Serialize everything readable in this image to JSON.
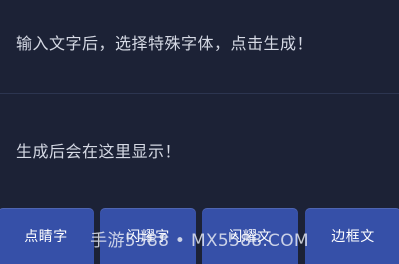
{
  "input": {
    "placeholder": "输入文字后，选择特殊字体，点击生成！"
  },
  "output": {
    "placeholder": "生成后会在这里显示！"
  },
  "buttons": [
    {
      "label": "点睛字"
    },
    {
      "label": "闪耀字"
    },
    {
      "label": "闪耀文"
    },
    {
      "label": "边框文"
    }
  ],
  "watermark": {
    "text": "手游5588 • MX5588.COM"
  },
  "colors": {
    "background": "#1c2236",
    "button": "#3650a8",
    "text": "#d5d9e4"
  }
}
